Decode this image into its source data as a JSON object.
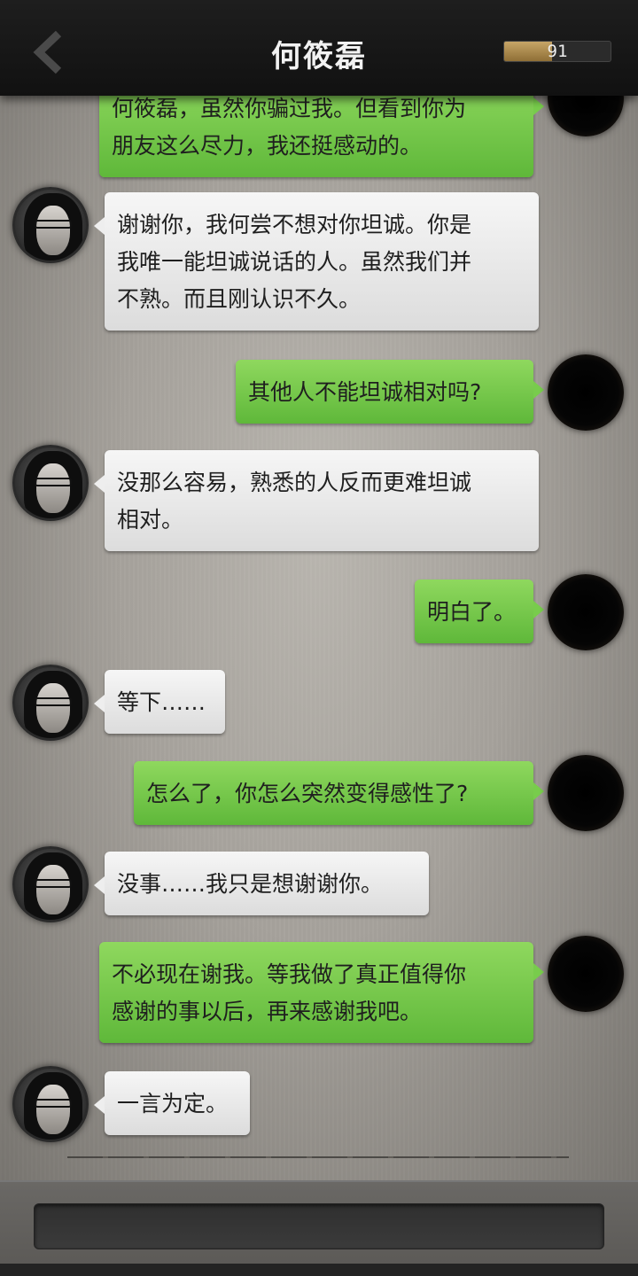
{
  "header": {
    "title": "何筱磊",
    "meter_value": "91",
    "meter_fill": 0.45
  },
  "messages": [
    {
      "sender": "player",
      "text": "何筱磊，虽然你骗过我。但看到你为\n朋友这么尽力，我还挺感动的。"
    },
    {
      "sender": "npc",
      "text": "谢谢你，我何尝不想对你坦诚。你是\n我唯一能坦诚说话的人。虽然我们并\n不熟。而且刚认识不久。"
    },
    {
      "sender": "player",
      "text": "其他人不能坦诚相对吗?"
    },
    {
      "sender": "npc",
      "text": "没那么容易，熟悉的人反而更难坦诚\n相对。"
    },
    {
      "sender": "player",
      "text": "明白了。"
    },
    {
      "sender": "npc",
      "text": "等下……"
    },
    {
      "sender": "player",
      "text": "怎么了，你怎么突然变得感性了?"
    },
    {
      "sender": "npc",
      "text": "没事……我只是想谢谢你。"
    },
    {
      "sender": "player",
      "text": "不必现在谢我。等我做了真正值得你\n感谢的事以后，再来感谢我吧。"
    },
    {
      "sender": "npc",
      "text": "一言为定。"
    }
  ],
  "colors": {
    "player_bubble": "#6cc545",
    "npc_bubble": "#e8e8e8",
    "header_bg": "#171717"
  },
  "icons": {
    "back": "chevron-left-icon"
  }
}
